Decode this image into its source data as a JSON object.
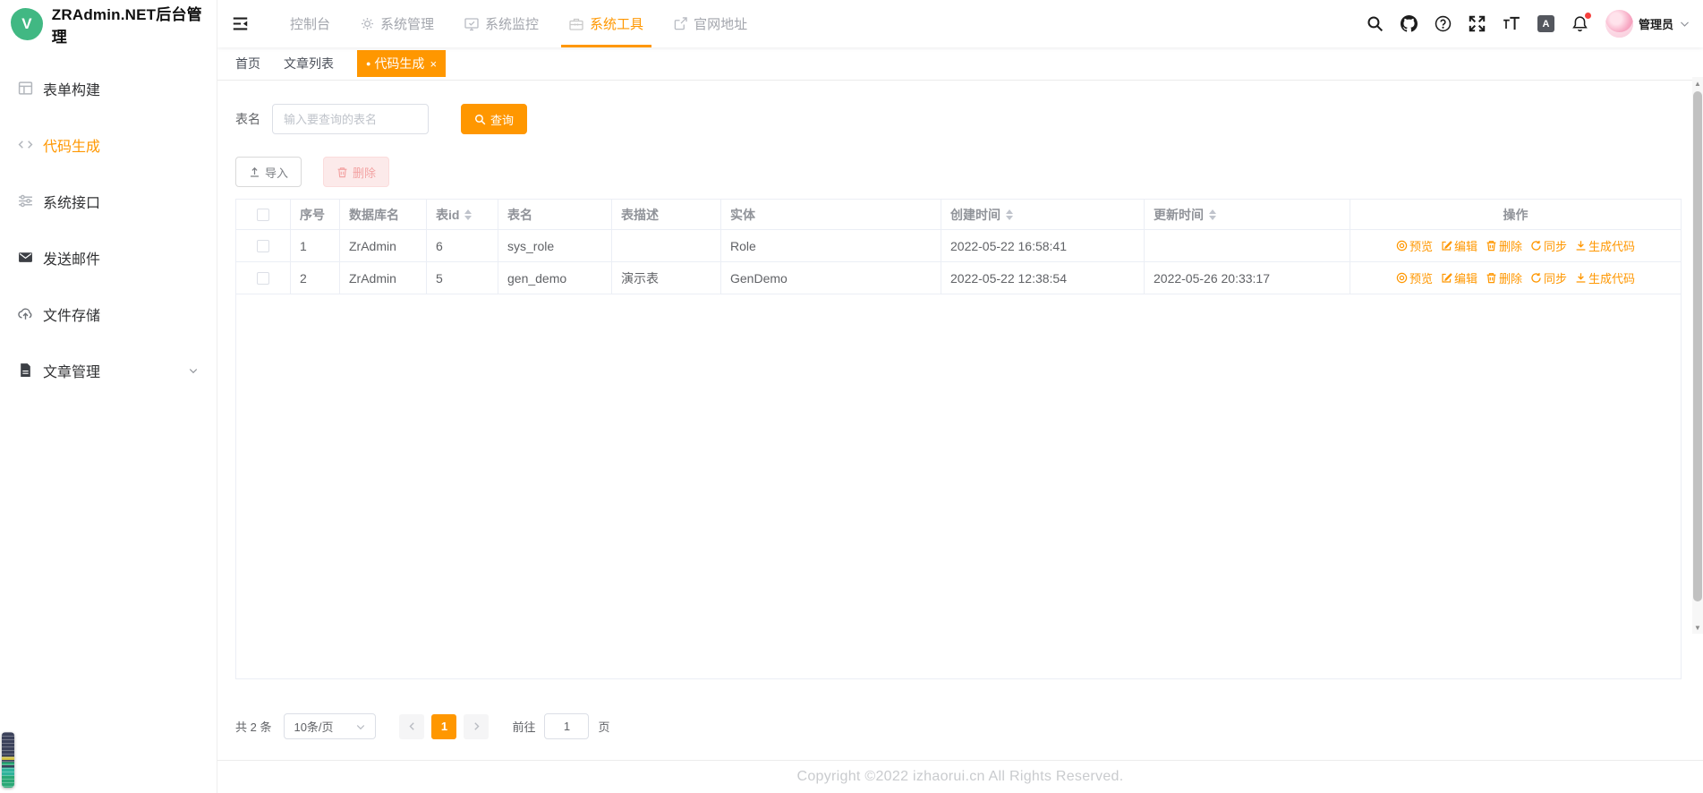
{
  "app": {
    "logo_letter": "V",
    "title": "ZRAdmin.NET后台管理"
  },
  "colors": {
    "accent": "#ff9700",
    "logo_green": "#41b883",
    "danger_light": "#fceaea",
    "notification_dot": "#f5413e"
  },
  "topnav": {
    "items": [
      {
        "label": "控制台",
        "icon": "none",
        "active": false
      },
      {
        "label": "系统管理",
        "icon": "gear-icon",
        "active": false
      },
      {
        "label": "系统监控",
        "icon": "monitor-icon",
        "active": false
      },
      {
        "label": "系统工具",
        "icon": "toolbox-icon",
        "active": true
      },
      {
        "label": "官网地址",
        "icon": "external-link-icon",
        "active": false
      }
    ]
  },
  "topbar_right": {
    "icons": [
      "search-icon",
      "github-icon",
      "help-icon",
      "fullscreen-icon",
      "font-size-icon",
      "translate-icon",
      "bell-icon"
    ],
    "translate_letter": "A",
    "user_name": "管理员"
  },
  "sidebar": {
    "items": [
      {
        "label": "表单构建",
        "icon": "form-builder-icon",
        "active": false
      },
      {
        "label": "代码生成",
        "icon": "code-icon",
        "active": true
      },
      {
        "label": "系统接口",
        "icon": "sliders-icon",
        "active": false
      },
      {
        "label": "发送邮件",
        "icon": "mail-icon",
        "active": false
      },
      {
        "label": "文件存储",
        "icon": "cloud-upload-icon",
        "active": false
      },
      {
        "label": "文章管理",
        "icon": "document-icon",
        "active": false,
        "expandable": true
      }
    ]
  },
  "tabs": [
    {
      "label": "首页",
      "active": false
    },
    {
      "label": "文章列表",
      "active": false
    },
    {
      "label": "代码生成",
      "active": true,
      "closable": true,
      "dot": "●",
      "close": "×"
    }
  ],
  "search": {
    "label": "表名",
    "placeholder": "输入要查询的表名",
    "button": "查询"
  },
  "toolbar": {
    "import": "导入",
    "delete": "删除"
  },
  "table": {
    "columns": [
      "序号",
      "数据库名",
      "表id",
      "表名",
      "表描述",
      "实体",
      "创建时间",
      "更新时间",
      "操作"
    ],
    "sortable": [
      "表id",
      "创建时间",
      "更新时间"
    ],
    "actions": [
      "预览",
      "编辑",
      "删除",
      "同步",
      "生成代码"
    ],
    "rows": [
      {
        "seq": "1",
        "db": "ZrAdmin",
        "table_id": "6",
        "name": "sys_role",
        "desc": "",
        "entity": "Role",
        "created": "2022-05-22 16:58:41",
        "updated": ""
      },
      {
        "seq": "2",
        "db": "ZrAdmin",
        "table_id": "5",
        "name": "gen_demo",
        "desc": "演示表",
        "entity": "GenDemo",
        "created": "2022-05-22 12:38:54",
        "updated": "2022-05-26 20:33:17"
      }
    ]
  },
  "pagination": {
    "total": "共 2 条",
    "page_size": "10条/页",
    "current_page": "1",
    "goto_label": "前往",
    "goto_value": "1",
    "page_suffix": "页"
  },
  "footer": {
    "copyright": "Copyright ©2022 izhaorui.cn All Rights Reserved."
  }
}
